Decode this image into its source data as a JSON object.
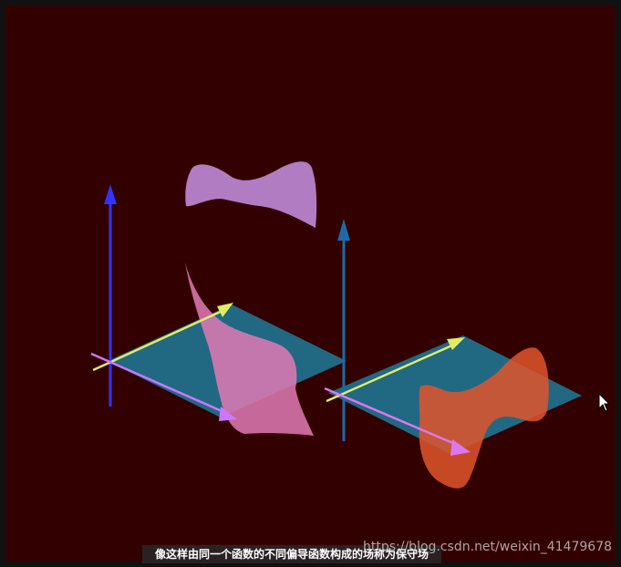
{
  "video": {
    "subtitle": "像这样由同一个函数的不同偏导函数构成的场称为保守场",
    "watermark": "https://blog.csdn.net/weixin_41479678"
  },
  "scene": {
    "background_color": "#330000",
    "left_plane": {
      "plane_color": "#1f7a9a",
      "z_axis_color": "#3333ff",
      "x_axis_color": "#cc77ff",
      "y_axis_color": "#ddee66",
      "surface_color": "#e07ab4",
      "floating_surface_color": "#c08ad8"
    },
    "right_plane": {
      "plane_color": "#1f7a9a",
      "z_axis_color": "#1c6aa8",
      "x_axis_color": "#dd77ee",
      "y_axis_color": "#ddee66",
      "surface_color": "#e0552a"
    }
  },
  "cursor": {
    "icon": "mouse-pointer-icon"
  }
}
